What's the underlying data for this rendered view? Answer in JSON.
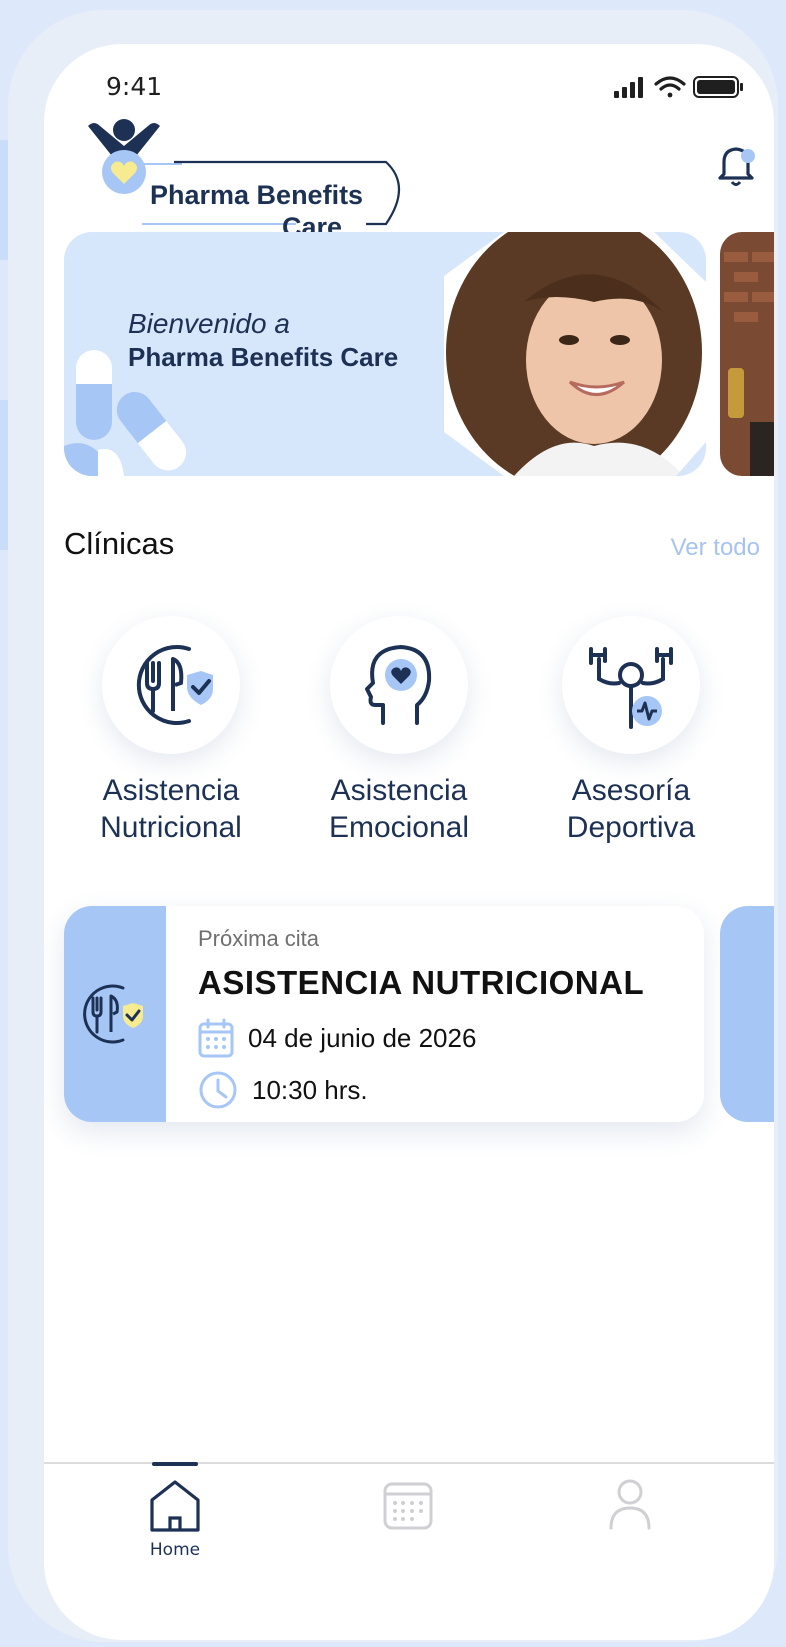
{
  "status_bar": {
    "time": "9:41"
  },
  "header": {
    "logo_line1": "Pharma Benefits",
    "logo_line2": "Care",
    "notification_icon": "bell-icon"
  },
  "banner": {
    "greeting": "Bienvenido a",
    "brand": "Pharma Benefits Care"
  },
  "clinics": {
    "title": "Clínicas",
    "see_all": "Ver todo",
    "items": [
      {
        "line1": "Asistencia",
        "line2": "Nutricional",
        "icon": "nutrition-icon"
      },
      {
        "line1": "Asistencia",
        "line2": "Emocional",
        "icon": "mental-health-icon"
      },
      {
        "line1": "Asesoría",
        "line2": "Deportiva",
        "icon": "fitness-icon"
      }
    ]
  },
  "appointment": {
    "caption": "Próxima cita",
    "title": "ASISTENCIA NUTRICIONAL",
    "date": "04 de junio de 2026",
    "time": "10:30 hrs."
  },
  "tabbar": {
    "items": [
      {
        "label": "Home",
        "icon": "home-icon",
        "active": true
      },
      {
        "label": "",
        "icon": "calendar-icon",
        "active": false
      },
      {
        "label": "",
        "icon": "profile-icon",
        "active": false
      }
    ]
  },
  "colors": {
    "navy": "#1d3155",
    "accent_blue": "#a6c6f6",
    "light_blue": "#d6e6fb",
    "heart_yellow": "#f7eb8f"
  }
}
